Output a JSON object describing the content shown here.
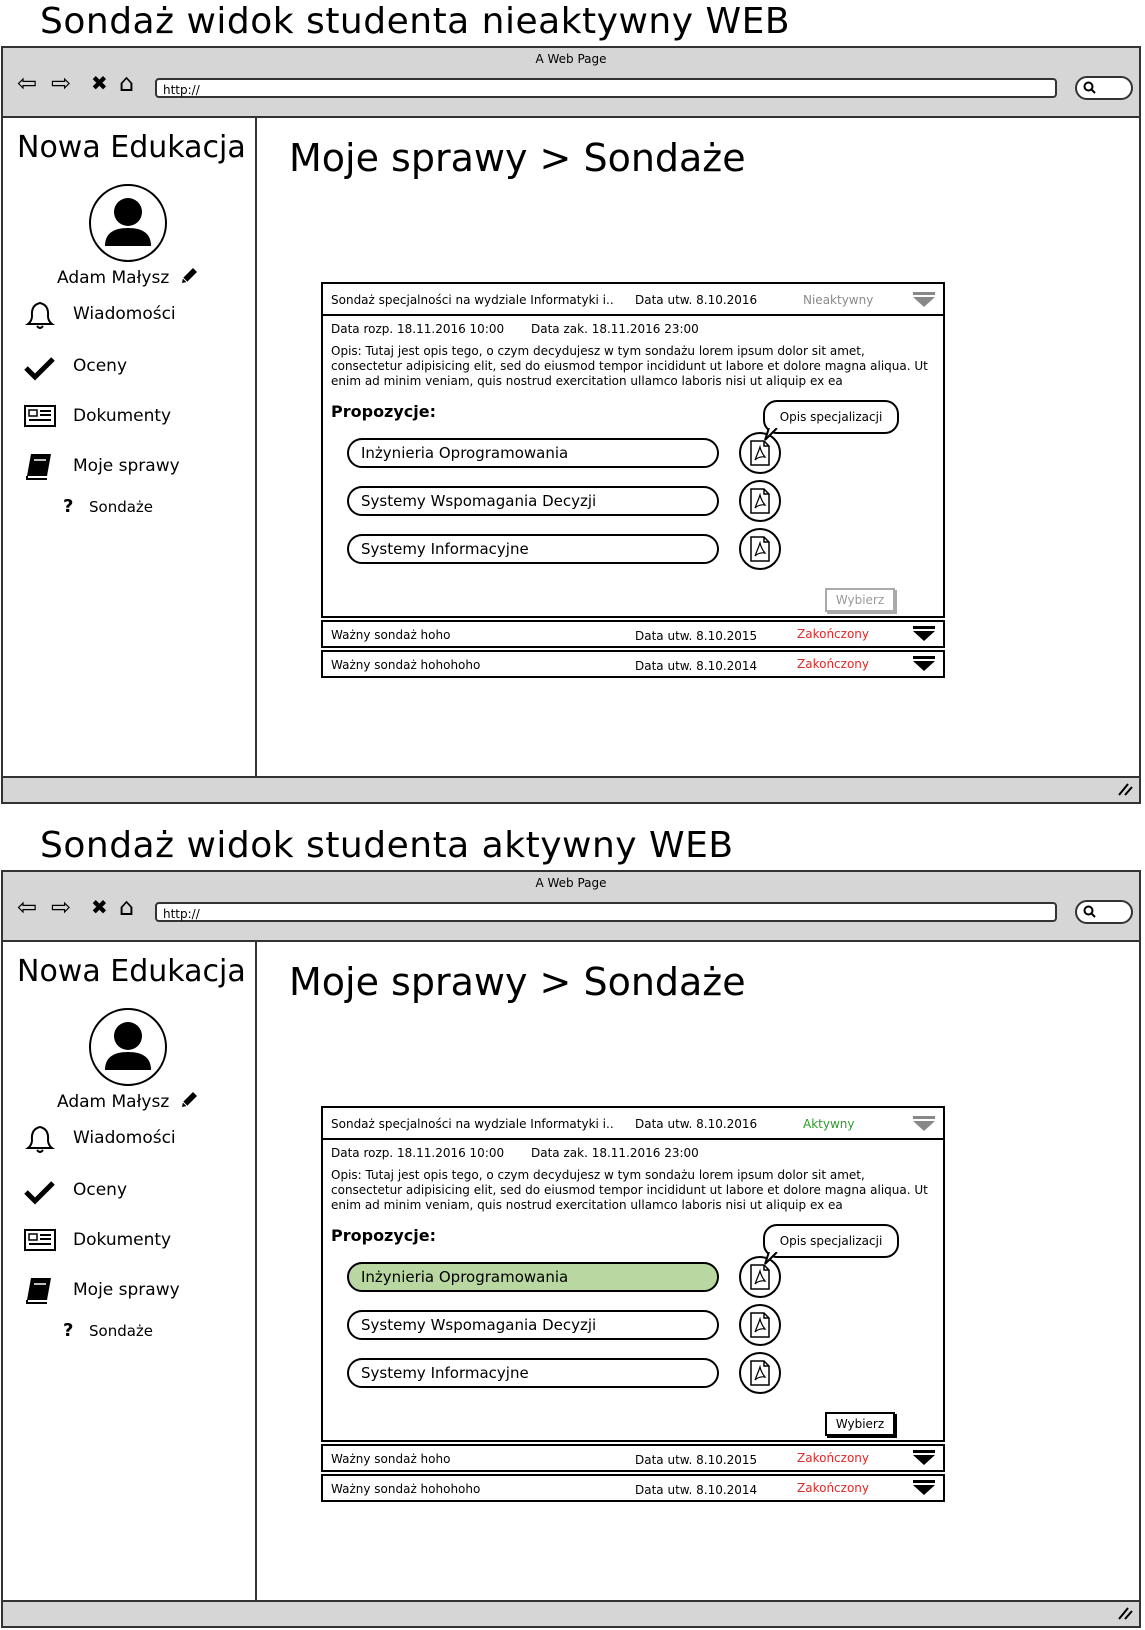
{
  "mockups": [
    {
      "title": "Sondaż widok studenta nieaktywny WEB",
      "browser": {
        "page_title": "A Web Page",
        "url": "http://",
        "nav": {
          "back": "⇦",
          "forward": "⇨",
          "close": "✖",
          "home": "⌂"
        }
      },
      "sidebar": {
        "brand": "Nowa Edukacja",
        "user_name": "Adam Małysz",
        "items": [
          {
            "label": "Wiadomości",
            "icon": "bell-icon"
          },
          {
            "label": "Oceny",
            "icon": "checkmark-icon"
          },
          {
            "label": "Dokumenty",
            "icon": "document-icon"
          },
          {
            "label": "Moje sprawy",
            "icon": "book-icon"
          }
        ],
        "sub_item": {
          "label": "Sondaże",
          "icon": "?"
        }
      },
      "breadcrumb": "Moje sprawy > Sondaże",
      "survey": {
        "title": "Sondaż specjalności na wydziale Informatyki i...",
        "created": "Data utw. 8.10.2016",
        "status": "Nieaktywny",
        "status_color": "#8a8a8a",
        "start": "Data rozp. 18.11.2016 10:00",
        "end": "Data zak. 18.11.2016 23:00",
        "description": "Opis: Tutaj jest opis tego, o czym decydujesz w tym sondażu lorem ipsum dolor sit amet, consectetur adipisicing elit, sed do eiusmod tempor incididunt ut labore et dolore magna aliqua. Ut enim ad minim veniam, quis nostrud exercitation ullamco laboris nisi ut aliquip ex ea",
        "proposals_heading": "Propozycje:",
        "proposals": [
          "Inżynieria Oprogramowania",
          "Systemy Wspomagania Decyzji",
          "Systemy Informacyjne"
        ],
        "selected_index": null,
        "selected_color": "#b9d7a1",
        "tooltip": "Opis specjalizacji",
        "select_button": "Wybierz",
        "select_enabled": false
      },
      "other_surveys": [
        {
          "title": "Ważny sondaż hoho",
          "created": "Data utw. 8.10.2015",
          "status": "Zakończony",
          "status_color": "#d62c2c"
        },
        {
          "title": "Ważny sondaż hohohoho",
          "created": "Data utw. 8.10.2014",
          "status": "Zakończony",
          "status_color": "#d62c2c"
        }
      ]
    },
    {
      "title": "Sondaż widok studenta aktywny WEB",
      "browser": {
        "page_title": "A Web Page",
        "url": "http://",
        "nav": {
          "back": "⇦",
          "forward": "⇨",
          "close": "✖",
          "home": "⌂"
        }
      },
      "sidebar": {
        "brand": "Nowa Edukacja",
        "user_name": "Adam Małysz",
        "items": [
          {
            "label": "Wiadomości",
            "icon": "bell-icon"
          },
          {
            "label": "Oceny",
            "icon": "checkmark-icon"
          },
          {
            "label": "Dokumenty",
            "icon": "document-icon"
          },
          {
            "label": "Moje sprawy",
            "icon": "book-icon"
          }
        ],
        "sub_item": {
          "label": "Sondaże",
          "icon": "?"
        }
      },
      "breadcrumb": "Moje sprawy > Sondaże",
      "survey": {
        "title": "Sondaż specjalności na wydziale Informatyki i...",
        "created": "Data utw. 8.10.2016",
        "status": "Aktywny",
        "status_color": "#2e9b2e",
        "start": "Data rozp. 18.11.2016 10:00",
        "end": "Data zak. 18.11.2016 23:00",
        "description": "Opis: Tutaj jest opis tego, o czym decydujesz w tym sondażu lorem ipsum dolor sit amet, consectetur adipisicing elit, sed do eiusmod tempor incididunt ut labore et dolore magna aliqua. Ut enim ad minim veniam, quis nostrud exercitation ullamco laboris nisi ut aliquip ex ea",
        "proposals_heading": "Propozycje:",
        "proposals": [
          "Inżynieria Oprogramowania",
          "Systemy Wspomagania Decyzji",
          "Systemy Informacyjne"
        ],
        "selected_index": 0,
        "selected_color": "#b9d7a1",
        "tooltip": "Opis specjalizacji",
        "select_button": "Wybierz",
        "select_enabled": true
      },
      "other_surveys": [
        {
          "title": "Ważny sondaż hoho",
          "created": "Data utw. 8.10.2015",
          "status": "Zakończony",
          "status_color": "#d62c2c"
        },
        {
          "title": "Ważny sondaż hohohoho",
          "created": "Data utw. 8.10.2014",
          "status": "Zakończony",
          "status_color": "#d62c2c"
        }
      ]
    }
  ]
}
